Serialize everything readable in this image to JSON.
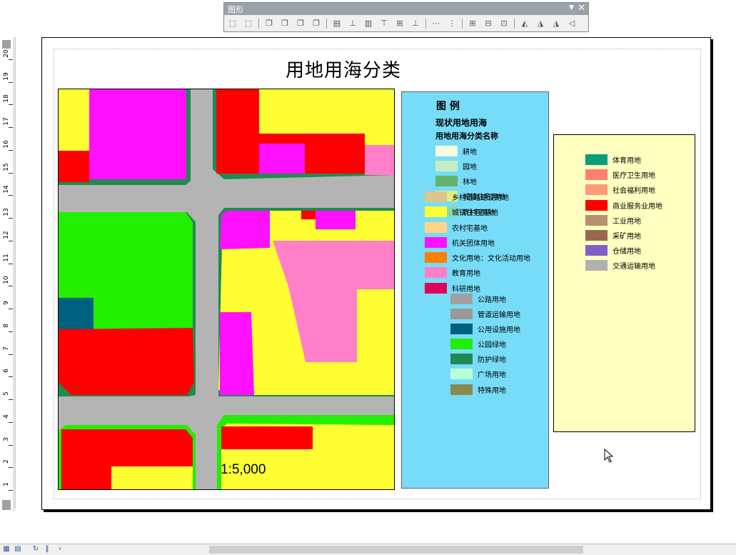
{
  "toolbar": {
    "title": "图形",
    "dropdown_icon": "triangle-down-icon",
    "close_label": "✕",
    "icons": [
      "select-elements-icon",
      "group-icon",
      "bring-to-front-icon",
      "send-to-back-icon",
      "bring-forward-icon",
      "send-backward-icon",
      "align-left-icon",
      "align-center-icon",
      "align-right-icon",
      "align-top-icon",
      "align-middle-icon",
      "align-bottom-icon",
      "distribute-horizontal-icon",
      "distribute-vertical-icon",
      "make-same-size-icon",
      "make-same-width-icon",
      "make-same-height-icon",
      "rotate-left-icon",
      "rotate-right-icon",
      "flip-horizontal-icon",
      "flip-vertical-icon"
    ]
  },
  "ruler": {
    "labels": [
      "1",
      "2",
      "3",
      "4",
      "5",
      "6",
      "7",
      "8",
      "9",
      "10",
      "11",
      "12",
      "13",
      "14",
      "15",
      "16",
      "17",
      "18",
      "19",
      "20"
    ]
  },
  "layout": {
    "title": "用地用海分类",
    "scale_text": "1:5,000"
  },
  "legend1": {
    "heading": "图    例",
    "layer_name": "现状用地用海",
    "field_name": "用地用海分类名称",
    "items": [
      {
        "label": "耕地",
        "color": "#fbfbe0"
      },
      {
        "label": "园地",
        "color": "#c7eec0"
      },
      {
        "label": "林地",
        "color": "#66b26b"
      },
      {
        "label": "城镇住宅用地",
        "color": "#e0ec80"
      },
      {
        "label": "乡村道路建设用地",
        "color": "#d9c78c"
      },
      {
        "label": "农村宅基地",
        "color": "#88d8b0"
      },
      {
        "label": "城镇住宅用地",
        "color": "#ffff33"
      },
      {
        "label": "农村宅基地",
        "color": "#ffd58a"
      },
      {
        "label": "机关团体用地",
        "color": "#ff10ff"
      },
      {
        "label": "文化用地：文化活动用地",
        "color": "#ff8000"
      },
      {
        "label": "教育用地",
        "color": "#ff80c8"
      },
      {
        "label": "科研用地",
        "color": "#e0005a"
      },
      {
        "label": "公路用地",
        "color": "#a0a0a0"
      },
      {
        "label": "管道运输用地",
        "color": "#999999"
      },
      {
        "label": "公用设施用地",
        "color": "#006080"
      },
      {
        "label": "公园绿地",
        "color": "#22ee00"
      },
      {
        "label": "防护绿地",
        "color": "#1e8a50"
      },
      {
        "label": "广场用地",
        "color": "#b8ffd8"
      },
      {
        "label": "特殊用地",
        "color": "#8a8a50"
      }
    ]
  },
  "legend2": {
    "items": [
      {
        "label": "体育用地",
        "color": "#0a9e78"
      },
      {
        "label": "医疗卫生用地",
        "color": "#ff8070"
      },
      {
        "label": "社会福利用地",
        "color": "#ff9a78"
      },
      {
        "label": "商业服务业用地",
        "color": "#ff0000"
      },
      {
        "label": "工业用地",
        "color": "#b89070"
      },
      {
        "label": "采矿用地",
        "color": "#9a6850"
      },
      {
        "label": "仓储用地",
        "color": "#8060c8"
      },
      {
        "label": "交通运输用地",
        "color": "#b0b0b0"
      }
    ]
  },
  "statusbar": {
    "icons": [
      "data-view-icon",
      "layout-view-icon",
      "refresh-icon",
      "pause-icon",
      "scroll-left-icon"
    ]
  }
}
